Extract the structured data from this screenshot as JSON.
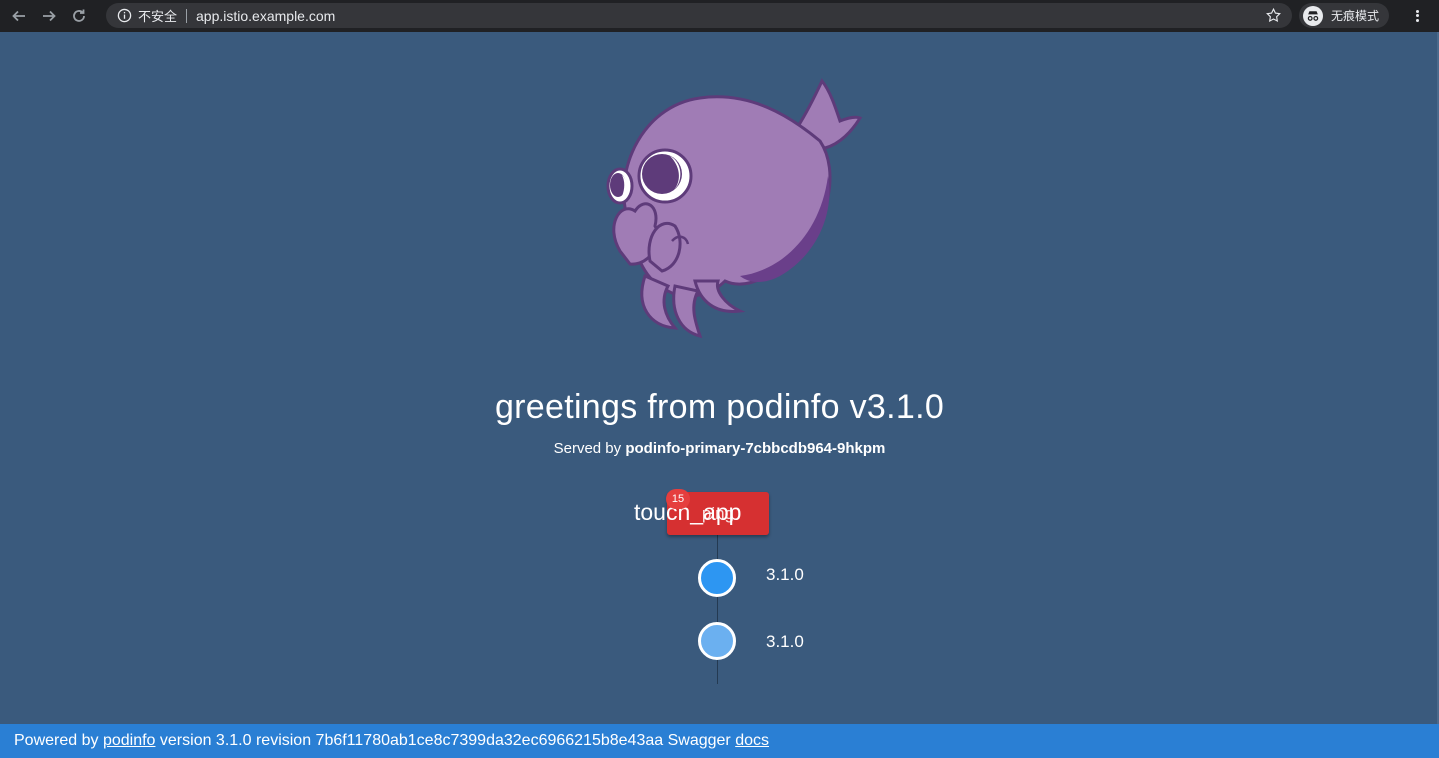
{
  "browser": {
    "security_label": "不安全",
    "url": "app.istio.example.com",
    "incognito_label": "无痕模式",
    "icons": [
      "back-icon",
      "forward-icon",
      "reload-icon",
      "info-icon",
      "star-icon",
      "incognito-icon",
      "menu-icon"
    ]
  },
  "page": {
    "title": "greetings from podinfo v3.1.0",
    "served_prefix": "Served by",
    "served_host": "podinfo-primary-7cbbcdb964-9hkpm",
    "touch_button_label": "ping",
    "touch_text": "touch_app",
    "badge_count": "15",
    "timeline": [
      {
        "version": "3.1.0",
        "color": "#2d96f2"
      },
      {
        "version": "3.1.0",
        "color": "#6bb0f0"
      }
    ]
  },
  "footer": {
    "powered_by": "Powered by",
    "podinfo_link": "podinfo",
    "version_text": "version 3.1.0 revision 7b6f11780ab1ce8c7399da32ec6966215b8e43aa Swagger",
    "docs_link": "docs"
  },
  "colors": {
    "background": "#3a5a7d",
    "footer": "#2a7fd4",
    "button": "#d63031",
    "mascot": "#a07cb5"
  }
}
